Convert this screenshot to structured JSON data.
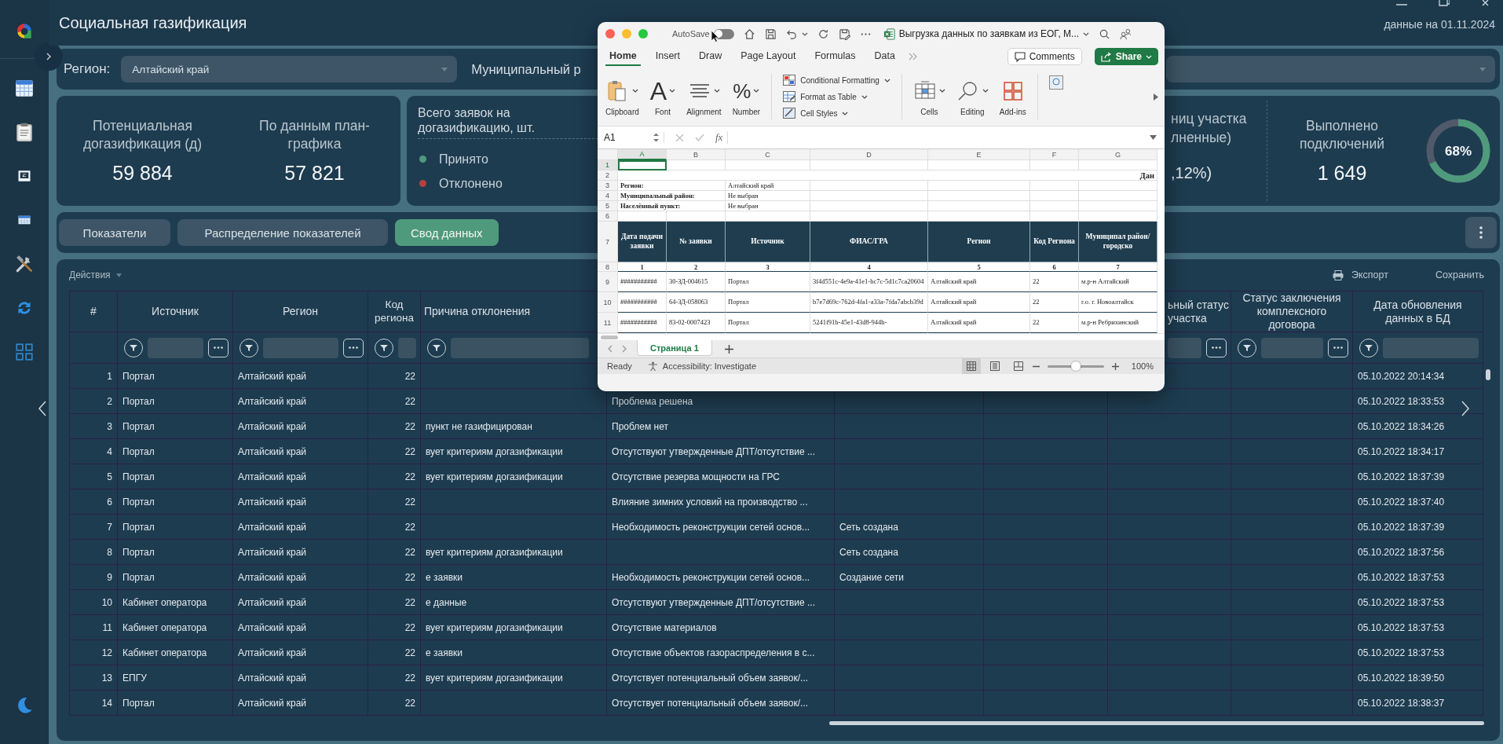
{
  "app": {
    "title": "Социальная газификация",
    "data_date": "данные на 01.11.2024"
  },
  "filters": [
    {
      "label": "Регион:",
      "value": "Алтайский край"
    },
    {
      "label": "Муниципальный р"
    }
  ],
  "kpi_metrics": [
    {
      "label": "Потенциальная догазификация (д)",
      "value": "59 884"
    },
    {
      "label": "По данным план-графика",
      "value": "57 821"
    }
  ],
  "requests": {
    "title": "Всего заявок на догазификацию, шт.",
    "legend": [
      {
        "label": "Принято",
        "color": "#4f9a7c"
      },
      {
        "label": "Отклонено",
        "color": "#b3413f"
      }
    ]
  },
  "partial_metric": {
    "label_lines": [
      "ниц участка",
      "лненные)"
    ],
    "value": ",12%)"
  },
  "connections": {
    "label": "Выполнено подключений",
    "value": "1 649",
    "percent": "68%",
    "level": 0.68
  },
  "tabs": [
    {
      "label": "Показатели",
      "selected": false
    },
    {
      "label": "Распределение показателей",
      "selected": false
    },
    {
      "label": "Свод данных",
      "selected": true
    }
  ],
  "table": {
    "actions": "Действия",
    "export": "Экспорт",
    "save": "Сохранить",
    "columns": {
      "num": "#",
      "source": "Источник",
      "region": "Регион",
      "code": "Код региона",
      "reason": "Причина отклонения",
      "column_9": "ьный статус участка",
      "column_10": "Статус заключения комплексного договора",
      "updated": "Дата обновления данных в БД"
    },
    "rows": [
      {
        "num": "1",
        "source": "Портал",
        "region": "Алтайский край",
        "code": "22",
        "updated": "05.10.2022 20:14:34"
      },
      {
        "num": "2",
        "source": "Портал",
        "region": "Алтайский край",
        "code": "22",
        "column_6": "Проблема решена",
        "updated": "05.10.2022 18:33:53"
      },
      {
        "num": "3",
        "source": "Портал",
        "region": "Алтайский край",
        "code": "22",
        "reason": "пункт не газифицирован",
        "column_6": "Проблем нет",
        "updated": "05.10.2022 18:34:26"
      },
      {
        "num": "4",
        "source": "Портал",
        "region": "Алтайский край",
        "code": "22",
        "reason": "вует критериям догазификации",
        "column_6": "Отсутствуют утвержденные ДПТ/отсутствие ...",
        "updated": "05.10.2022 18:34:17"
      },
      {
        "num": "5",
        "source": "Портал",
        "region": "Алтайский край",
        "code": "22",
        "reason": "вует критериям догазификации",
        "column_6": "Отсутствие резерва мощности на ГРС",
        "updated": "05.10.2022 18:37:39"
      },
      {
        "num": "6",
        "source": "Портал",
        "region": "Алтайский край",
        "code": "22",
        "column_6": "Влияние зимних условий на производство ...",
        "updated": "05.10.2022 18:37:40"
      },
      {
        "num": "7",
        "source": "Портал",
        "region": "Алтайский край",
        "code": "22",
        "column_6": "Необходимость реконструкции сетей основ...",
        "column_7": "Сеть создана",
        "updated": "05.10.2022 18:37:39"
      },
      {
        "num": "8",
        "source": "Портал",
        "region": "Алтайский край",
        "code": "22",
        "reason": "вует критериям догазификации",
        "column_7": "Сеть создана",
        "updated": "05.10.2022 18:37:56"
      },
      {
        "num": "9",
        "source": "Портал",
        "region": "Алтайский край",
        "code": "22",
        "reason": "е заявки",
        "column_6": "Необходимость реконструкции сетей основ...",
        "column_7": "Создание сети",
        "updated": "05.10.2022 18:37:53"
      },
      {
        "num": "10",
        "source": "Кабинет оператора",
        "region": "Алтайский край",
        "code": "22",
        "reason": "е данные",
        "column_6": "Отсутствуют утвержденные ДПТ/отсутствие ...",
        "updated": "05.10.2022 18:37:53"
      },
      {
        "num": "11",
        "source": "Кабинет оператора",
        "region": "Алтайский край",
        "code": "22",
        "reason": "вует критериям догазификации",
        "column_6": "Отсутствие материалов",
        "updated": "05.10.2022 18:37:53"
      },
      {
        "num": "12",
        "source": "Кабинет оператора",
        "region": "Алтайский край",
        "code": "22",
        "reason": "е заявки",
        "column_6": "Отсутствие объектов газораспределения в с...",
        "updated": "05.10.2022 18:37:53"
      },
      {
        "num": "13",
        "source": "ЕПГУ",
        "region": "Алтайский край",
        "code": "22",
        "reason": "вует критериям догазификации",
        "column_6": "Отсутствует потенциальный объем заявок/...",
        "updated": "05.10.2022 18:39:50"
      },
      {
        "num": "14",
        "source": "Портал",
        "region": "Алтайский край",
        "code": "22",
        "column_6": "Отсутствует потенциальный объем заявок/...",
        "updated": "05.10.2022 18:38:37"
      }
    ]
  },
  "excel": {
    "autosave": {
      "label": "AutoSave",
      "on": false
    },
    "title": "Выгрузка данных по заявкам из ЕОГ, М...",
    "ribbon_tabs": [
      {
        "label": "Home",
        "selected": true
      },
      {
        "label": "Insert",
        "selected": false
      },
      {
        "label": "Draw",
        "selected": false
      },
      {
        "label": "Page Layout",
        "selected": false
      },
      {
        "label": "Formulas",
        "selected": false
      },
      {
        "label": "Data",
        "selected": false
      }
    ],
    "comments": "Comments",
    "share": "Share",
    "groups": [
      {
        "kind": "clipboard",
        "label": "Clipboard"
      },
      {
        "kind": "font",
        "label": "Font",
        "glyph": "A"
      },
      {
        "kind": "alignment",
        "label": "Alignment"
      },
      {
        "kind": "number",
        "label": "Number",
        "glyph": "%"
      }
    ],
    "styles": [
      {
        "kind": "conditional",
        "label": "Conditional Formatting"
      },
      {
        "kind": "table",
        "label": "Format as Table"
      },
      {
        "kind": "cell",
        "label": "Cell Styles"
      }
    ],
    "groups_right": [
      {
        "kind": "cells",
        "label": "Cells"
      },
      {
        "kind": "editing",
        "label": "Editing"
      },
      {
        "kind": "addins",
        "label": "Add-ins"
      }
    ],
    "name_box": "A1",
    "fx": "fx",
    "columns": [
      {
        "label": "A",
        "selected": true
      },
      {
        "label": "B",
        "selected": false
      },
      {
        "label": "C",
        "selected": false
      },
      {
        "label": "D",
        "selected": false
      },
      {
        "label": "E",
        "selected": false
      },
      {
        "label": "F",
        "selected": false
      },
      {
        "label": "G",
        "selected": false
      }
    ],
    "rows": [
      {
        "num": "1",
        "kind": "blank",
        "selected": true
      },
      {
        "num": "2",
        "kind": "title",
        "selected": false,
        "cells": {
          "G": "Дан"
        }
      },
      {
        "num": "3",
        "kind": "info",
        "selected": false,
        "cells": {
          "A": "Регион:",
          "C": "Алтайский край"
        }
      },
      {
        "num": "4",
        "kind": "info",
        "selected": false,
        "cells": {
          "A": "Муниципальный район:",
          "C": "Не выбран"
        }
      },
      {
        "num": "5",
        "kind": "info",
        "selected": false,
        "cells": {
          "A": "Населённый пункт:",
          "C": "Не выбран"
        }
      },
      {
        "num": "6",
        "kind": "blank",
        "selected": false
      },
      {
        "num": "7",
        "kind": "header",
        "selected": false,
        "cells": {
          "A": "Дата подачи заявки",
          "B": "№ заявки",
          "C": "Источник",
          "D": "ФИАС/ГРА",
          "E": "Регион",
          "F": "Код Региона",
          "G": "Муниципал район/городско"
        }
      },
      {
        "num": "8",
        "kind": "index",
        "selected": false,
        "cells": {
          "A": "1",
          "B": "2",
          "C": "3",
          "D": "4",
          "E": "5",
          "F": "6",
          "G": "7"
        }
      },
      {
        "num": "9",
        "kind": "data",
        "selected": false,
        "cells": {
          "A": "###########",
          "B": "30-ЗД-004615",
          "C": "Портал",
          "D": "3f4d551c-4e9a-41e1-bc7c-5d1c7ca20604",
          "E": "Алтайский край",
          "F": "22",
          "G": "м.р-н Алтайский"
        }
      },
      {
        "num": "10",
        "kind": "data",
        "selected": false,
        "cells": {
          "A": "###########",
          "B": "64-ЗД-058063",
          "C": "Портал",
          "D": "b7e7d69c-762d-4fa1-a33a-7fda7abcb39d",
          "E": "Алтайский край",
          "F": "22",
          "G": "г.о. г. Новоалтайск"
        }
      },
      {
        "num": "11",
        "kind": "data",
        "selected": false,
        "cells": {
          "A": "###########",
          "B": "83-02-0007423",
          "C": "Портал",
          "D": "5241f91b-45e1-43d8-944b-",
          "E": "Алтайский край",
          "F": "22",
          "G": "м.р-н Ребрихинский"
        }
      }
    ],
    "sheet_tabs": [
      {
        "label": "Страница 1",
        "selected": true
      }
    ],
    "status": "Ready",
    "accessibility": "Accessibility: Investigate",
    "zoom": {
      "level": 0.5,
      "label": "100%"
    }
  }
}
